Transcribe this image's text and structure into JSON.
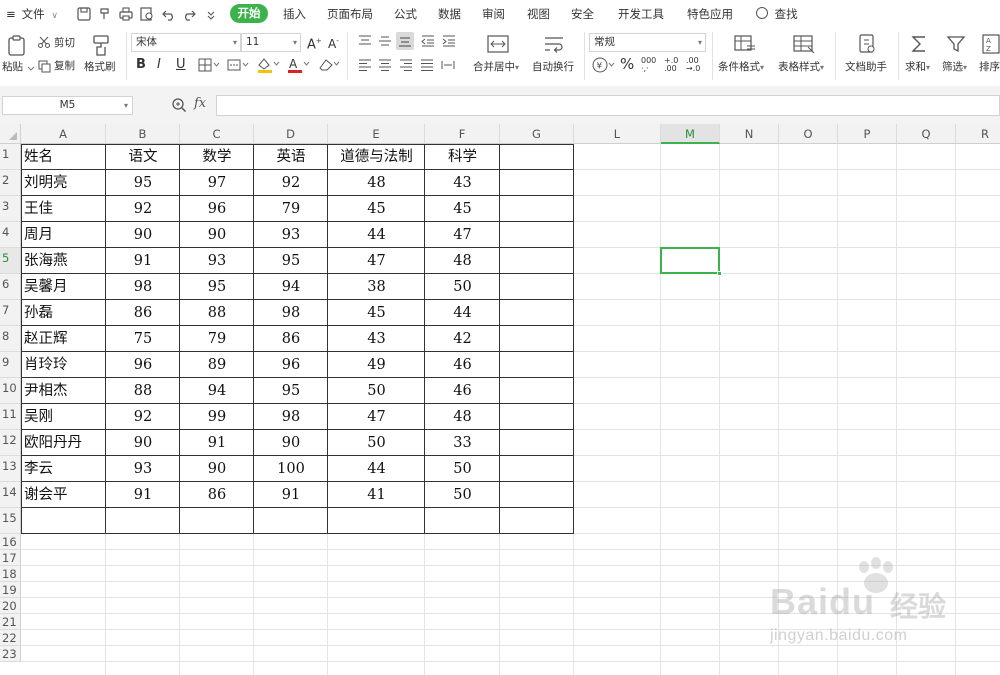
{
  "menubar": {
    "file_label": "文件",
    "tabs": [
      "开始",
      "插入",
      "页面布局",
      "公式",
      "数据",
      "审阅",
      "视图",
      "安全",
      "开发工具",
      "特色应用"
    ],
    "search_label": "查找",
    "accent": "#3bb24a"
  },
  "ribbon": {
    "paste": "粘贴",
    "cut": "剪切",
    "copy": "复制",
    "format_painter": "格式刷",
    "font_name": "宋体",
    "font_size": "11",
    "merge_center": "合并居中",
    "wrap_text": "自动换行",
    "number_format": "常规",
    "conditional_format": "条件格式",
    "table_style": "表格样式",
    "doc_assistant": "文档助手",
    "sum": "求和",
    "filter": "筛选",
    "sort": "排序"
  },
  "formula_bar": {
    "name_box": "M5",
    "fx": "fx",
    "value": ""
  },
  "sheet": {
    "columns": [
      "A",
      "B",
      "C",
      "D",
      "E",
      "F",
      "G",
      "L",
      "M",
      "N",
      "O",
      "P",
      "Q",
      "R"
    ],
    "selected_column": "M",
    "row_numbers": [
      "1",
      "2",
      "3",
      "4",
      "5",
      "6",
      "7",
      "8",
      "9",
      "10",
      "11",
      "12",
      "13",
      "14",
      "15",
      "16",
      "17",
      "18",
      "19",
      "20",
      "21",
      "22",
      "23"
    ],
    "selected_row": "5",
    "active_cell": "M5",
    "headers": [
      "姓名",
      "语文",
      "数学",
      "英语",
      "道德与法制",
      "科学"
    ],
    "rows": [
      [
        "刘明亮",
        "95",
        "97",
        "92",
        "48",
        "43"
      ],
      [
        "王佳",
        "92",
        "96",
        "79",
        "45",
        "45"
      ],
      [
        "周月",
        "90",
        "90",
        "93",
        "44",
        "47"
      ],
      [
        "张海燕",
        "91",
        "93",
        "95",
        "47",
        "48"
      ],
      [
        "吴馨月",
        "98",
        "95",
        "94",
        "38",
        "50"
      ],
      [
        "孙磊",
        "86",
        "88",
        "98",
        "45",
        "44"
      ],
      [
        "赵正辉",
        "75",
        "79",
        "86",
        "43",
        "42"
      ],
      [
        "肖玲玲",
        "96",
        "89",
        "96",
        "49",
        "46"
      ],
      [
        "尹相杰",
        "88",
        "94",
        "95",
        "50",
        "46"
      ],
      [
        "吴刚",
        "92",
        "99",
        "98",
        "47",
        "48"
      ],
      [
        "欧阳丹丹",
        "90",
        "91",
        "90",
        "50",
        "33"
      ],
      [
        "李云",
        "93",
        "90",
        "100",
        "44",
        "50"
      ],
      [
        "谢会平",
        "91",
        "86",
        "91",
        "41",
        "50"
      ]
    ]
  },
  "watermark": {
    "brand": "Bai",
    "brand2": "du",
    "cn": "经验",
    "url": "jingyan.baidu.com"
  }
}
